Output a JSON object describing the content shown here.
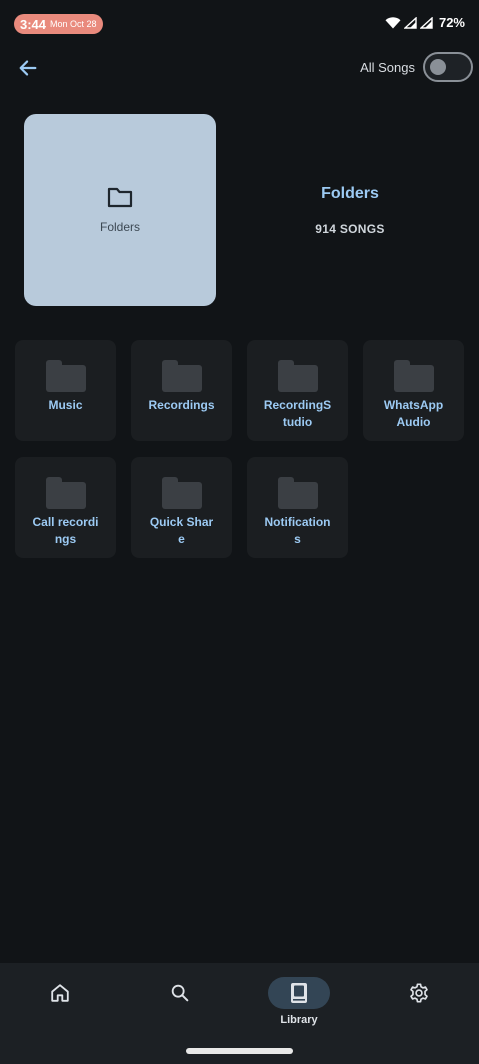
{
  "status_bar": {
    "time": "3:44",
    "date": "Mon Oct 28",
    "battery": "72%"
  },
  "top_bar": {
    "toggle_label": "All Songs",
    "toggle_on": false
  },
  "header": {
    "cover_label": "Folders",
    "title": "Folders",
    "song_count": "914 SONGS"
  },
  "folders": [
    {
      "name": "Music"
    },
    {
      "name": "Recordings"
    },
    {
      "name": "RecordingStudio"
    },
    {
      "name": "WhatsApp Audio"
    },
    {
      "name": "Call recordings"
    },
    {
      "name": "Quick Share"
    },
    {
      "name": "Notifications"
    }
  ],
  "bottom_nav": {
    "items": [
      {
        "icon": "home-icon"
      },
      {
        "icon": "search-icon"
      },
      {
        "icon": "library-icon",
        "label": "Library",
        "active": true
      },
      {
        "icon": "settings-gear-icon"
      }
    ]
  },
  "colors": {
    "accent": "#9ccaf3",
    "cover": "#b8cadb",
    "background": "#111417"
  }
}
